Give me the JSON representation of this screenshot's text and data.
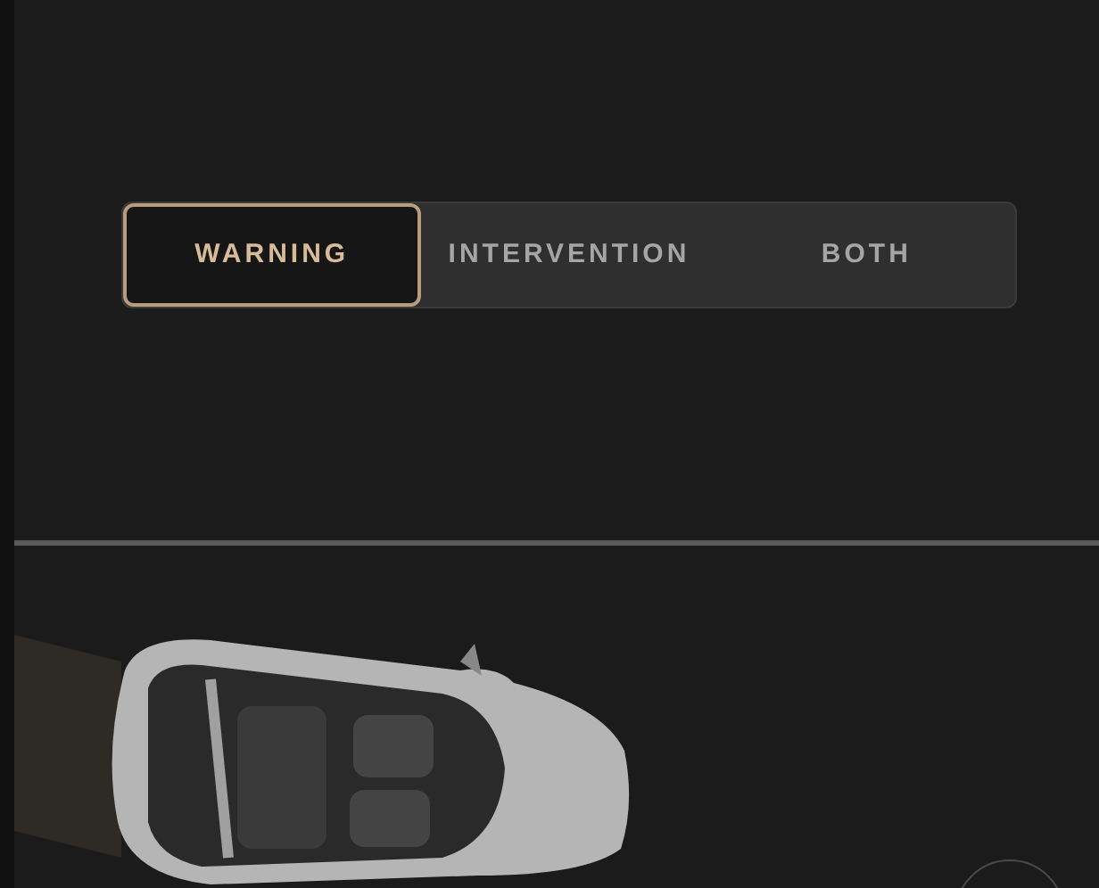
{
  "mode_selector": {
    "segments": [
      {
        "label": "WARNING",
        "selected": true
      },
      {
        "label": "INTERVENTION",
        "selected": false
      },
      {
        "label": "BOTH",
        "selected": false
      }
    ]
  }
}
